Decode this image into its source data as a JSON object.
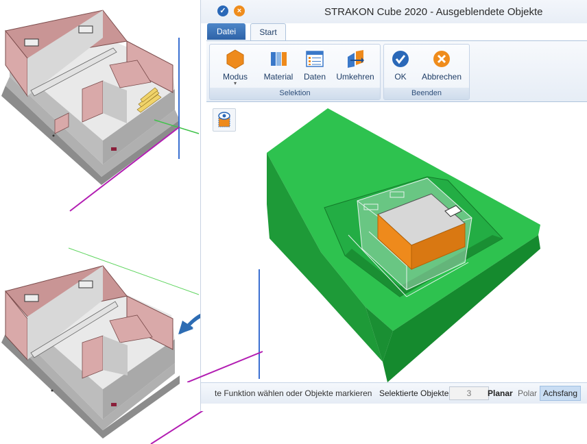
{
  "window": {
    "title": "STRAKON Cube 2020 - Ausgeblendete Objekte",
    "icons": [
      "check-circle-icon",
      "cancel-circle-icon"
    ]
  },
  "tabs": [
    {
      "label": "Datei",
      "active": false
    },
    {
      "label": "Start",
      "active": true
    }
  ],
  "ribbon": {
    "groups": [
      {
        "label": "Selektion",
        "buttons": [
          {
            "label": "Modus",
            "icon": "hexagon-mode-icon",
            "has_dropdown": true
          },
          {
            "label": "Material",
            "icon": "material-icon"
          },
          {
            "label": "Daten",
            "icon": "data-list-icon"
          },
          {
            "label": "Umkehren",
            "icon": "invert-selection-icon"
          }
        ]
      },
      {
        "label": "Beenden",
        "buttons": [
          {
            "label": "OK",
            "icon": "ok-check-icon"
          },
          {
            "label": "Abbrechen",
            "icon": "cancel-x-icon"
          }
        ]
      }
    ]
  },
  "viewport": {
    "tool_icon": "show-hidden-objects-icon"
  },
  "statusbar": {
    "message": "te Funktion wählen oder Objekte markieren",
    "selected_label": "Selektierte Objekte",
    "selected_count": "3",
    "planar": "Planar",
    "polar": "Polar",
    "achsfang": "Achsfang"
  },
  "colors": {
    "accent_blue": "#2e63a8",
    "terrain_green": "#2ec24f",
    "building_orange": "#ee8a1c",
    "wall_pink": "#d6a4a4"
  }
}
